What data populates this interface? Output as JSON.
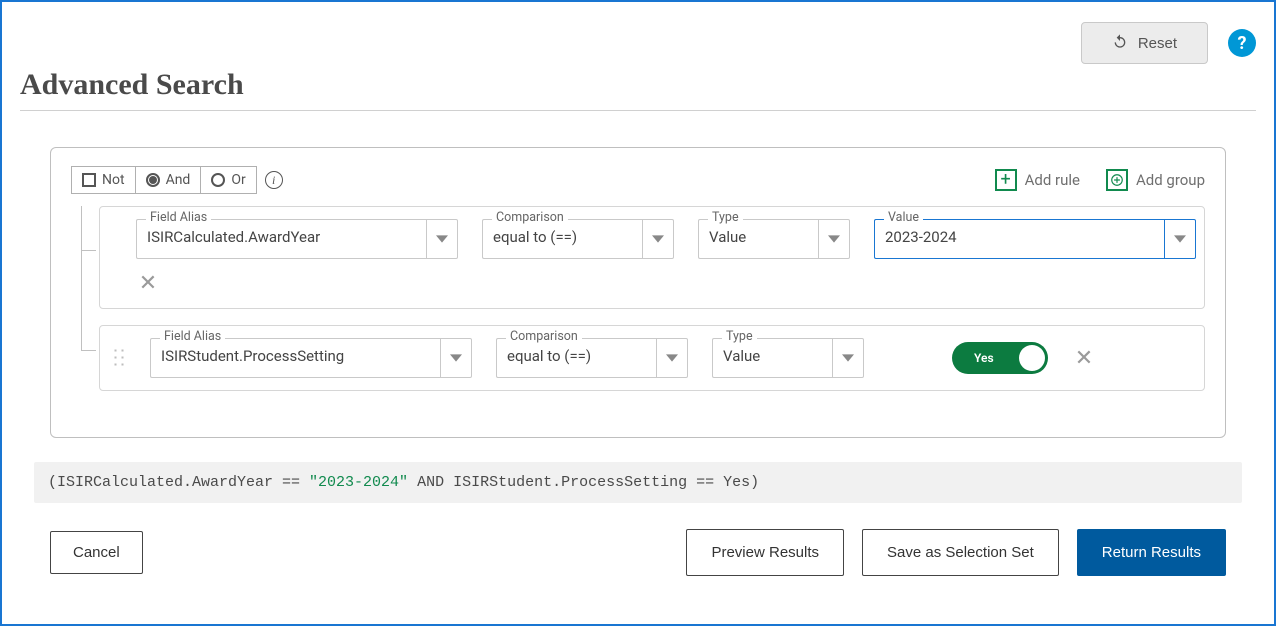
{
  "header": {
    "reset_label": "Reset",
    "help_label": "?"
  },
  "title": "Advanced Search",
  "group": {
    "not_label": "Not",
    "and_label": "And",
    "or_label": "Or",
    "selected": "and",
    "add_rule_label": "Add rule",
    "add_group_label": "Add group"
  },
  "labels": {
    "field_alias": "Field Alias",
    "comparison": "Comparison",
    "type": "Type",
    "value": "Value"
  },
  "rules": [
    {
      "field": "ISIRCalculated.AwardYear",
      "comparison": "equal to (==)",
      "type": "Value",
      "value_kind": "text",
      "value": "2023-2024"
    },
    {
      "field": "ISIRStudent.ProcessSetting",
      "comparison": "equal to (==)",
      "type": "Value",
      "value_kind": "toggle",
      "toggle_label": "Yes",
      "toggle_state": true
    }
  ],
  "expression": {
    "parts": [
      {
        "t": "plain",
        "v": "(ISIRCalculated.AwardYear == "
      },
      {
        "t": "str",
        "v": "\"2023-2024\""
      },
      {
        "t": "plain",
        "v": " AND ISIRStudent.ProcessSetting == Yes)"
      }
    ]
  },
  "footer": {
    "cancel": "Cancel",
    "preview": "Preview Results",
    "save_set": "Save as Selection Set",
    "return": "Return Results"
  }
}
